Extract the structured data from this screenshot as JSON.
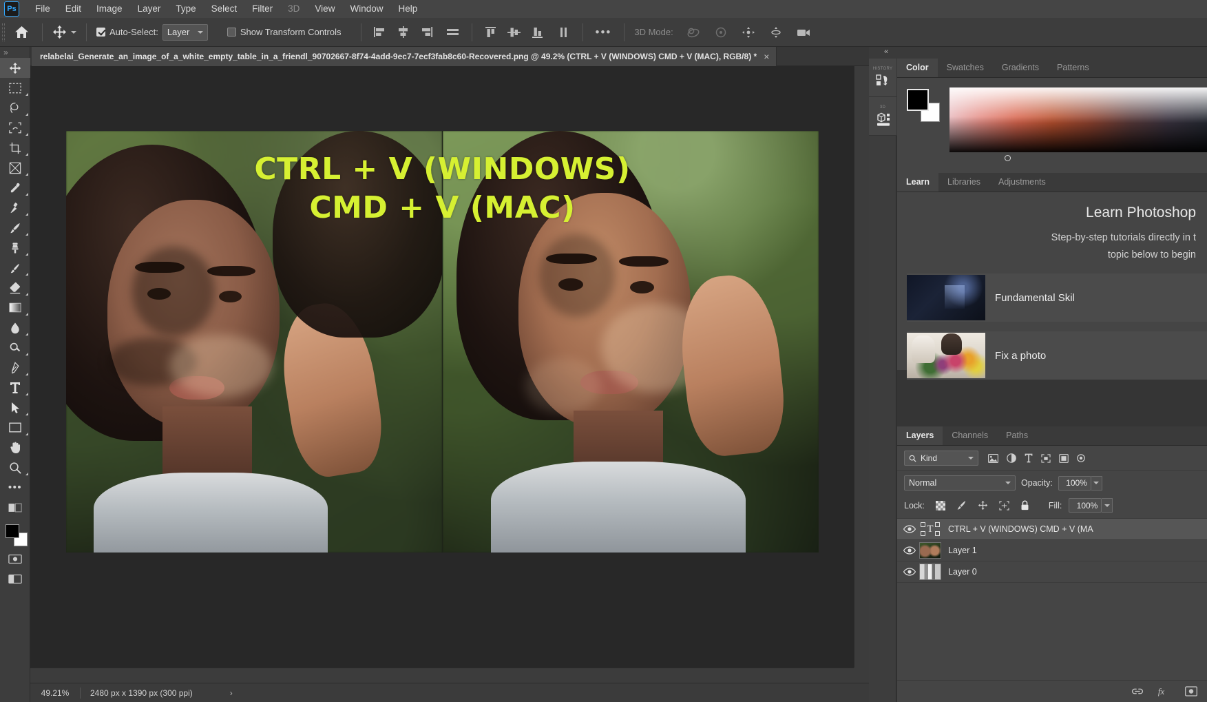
{
  "app": {
    "name": "Adobe Photoshop",
    "logo_text": "Ps"
  },
  "menubar": {
    "items": [
      {
        "label": "File"
      },
      {
        "label": "Edit"
      },
      {
        "label": "Image"
      },
      {
        "label": "Layer"
      },
      {
        "label": "Type"
      },
      {
        "label": "Select"
      },
      {
        "label": "Filter"
      },
      {
        "label": "3D"
      },
      {
        "label": "View"
      },
      {
        "label": "Window"
      },
      {
        "label": "Help"
      }
    ]
  },
  "options_bar": {
    "home_icon": "home-icon",
    "active_tool_icon": "move-tool-icon",
    "auto_select_label": "Auto-Select:",
    "auto_select_checked": true,
    "auto_select_value": "Layer",
    "show_transform_label": "Show Transform Controls",
    "show_transform_checked": false,
    "align_icons": [
      "align-left-edges-icon",
      "align-horizontal-centers-icon",
      "align-right-edges-icon",
      "distribute-vertical-centers-icon",
      "align-top-edges-icon",
      "align-vertical-centers-icon",
      "align-bottom-edges-icon",
      "distribute-icon"
    ],
    "more_label": "•••",
    "mode_3d_label": "3D Mode:",
    "mode_3d_icons": [
      "orbit-3d-icon",
      "roll-3d-icon",
      "pan-3d-icon",
      "slide-3d-icon",
      "camera-3d-icon"
    ]
  },
  "toolbar": {
    "tools": [
      {
        "name": "move-tool",
        "selected": true
      },
      {
        "name": "rectangular-marquee-tool",
        "selected": false
      },
      {
        "name": "lasso-tool",
        "selected": false
      },
      {
        "name": "object-selection-tool",
        "selected": false
      },
      {
        "name": "crop-tool",
        "selected": false
      },
      {
        "name": "frame-tool",
        "selected": false
      },
      {
        "name": "eyedropper-tool",
        "selected": false
      },
      {
        "name": "healing-brush-tool",
        "selected": false
      },
      {
        "name": "brush-tool",
        "selected": false
      },
      {
        "name": "clone-stamp-tool",
        "selected": false
      },
      {
        "name": "history-brush-tool",
        "selected": false
      },
      {
        "name": "eraser-tool",
        "selected": false
      },
      {
        "name": "gradient-tool",
        "selected": false
      },
      {
        "name": "blur-tool",
        "selected": false
      },
      {
        "name": "dodge-tool",
        "selected": false
      },
      {
        "name": "pen-tool",
        "selected": false
      },
      {
        "name": "type-tool",
        "selected": false
      },
      {
        "name": "path-selection-tool",
        "selected": false
      },
      {
        "name": "rectangle-tool",
        "selected": false
      },
      {
        "name": "hand-tool",
        "selected": false
      },
      {
        "name": "zoom-tool",
        "selected": false
      },
      {
        "name": "edit-toolbar-tool",
        "selected": false
      }
    ],
    "foreground_color": "#000000",
    "background_color": "#ffffff"
  },
  "document": {
    "tab_title": "relabelai_Generate_an_image_of_a_white_empty_table_in_a_friendl_90702667-8f74-4add-9ec7-7ecf3fab8c60-Recovered.png @ 49.2% (CTRL + V (WINDOWS) CMD + V (MAC), RGB/8) *",
    "close_label": "×",
    "overlay_line1": "CTRL + V (WINDOWS)",
    "overlay_line2": "CMD + V (MAC)",
    "overlay_color": "#d6f032"
  },
  "status_bar": {
    "zoom": "49.21%",
    "dimensions": "2480 px x 1390 px (300 ppi)",
    "arrow": "›"
  },
  "dock": {
    "collapse_icon": "collapse-panels-icon",
    "rail_buttons": [
      {
        "name": "history-rail-button",
        "caption": "HISTORY"
      },
      {
        "name": "3d-rail-button",
        "caption": "3D"
      }
    ],
    "color_group": {
      "tabs": [
        {
          "label": "Color",
          "active": true
        },
        {
          "label": "Swatches",
          "active": false
        },
        {
          "label": "Gradients",
          "active": false
        },
        {
          "label": "Patterns",
          "active": false
        }
      ],
      "foreground_color": "#000000",
      "background_color": "#ffffff"
    },
    "learn_group": {
      "tabs": [
        {
          "label": "Learn",
          "active": true
        },
        {
          "label": "Libraries",
          "active": false
        },
        {
          "label": "Adjustments",
          "active": false
        }
      ],
      "title": "Learn Photoshop",
      "subtitle_line1": "Step-by-step tutorials directly in t",
      "subtitle_line2": "topic below to begin",
      "cards": [
        {
          "title": "Fundamental Skil",
          "thumb": "room-photo-thumbnail"
        },
        {
          "title": "Fix a photo",
          "thumb": "flowers-photo-thumbnail"
        }
      ]
    },
    "layers_group": {
      "tabs": [
        {
          "label": "Layers",
          "active": true
        },
        {
          "label": "Channels",
          "active": false
        },
        {
          "label": "Paths",
          "active": false
        }
      ],
      "filter_label": "Kind",
      "filter_icons": [
        "filter-pixel-icon",
        "filter-adjustment-icon",
        "filter-type-icon",
        "filter-shape-icon",
        "filter-smart-object-icon",
        "filter-toggle-icon"
      ],
      "blend_mode": "Normal",
      "opacity_label": "Opacity:",
      "opacity_value": "100%",
      "lock_label": "Lock:",
      "lock_icons": [
        "lock-transparent-pixels-icon",
        "lock-image-pixels-icon",
        "lock-position-icon",
        "lock-artboard-nesting-icon",
        "lock-all-icon"
      ],
      "fill_label": "Fill:",
      "fill_value": "100%",
      "layers": [
        {
          "name": "CTRL + V (WINDOWS) CMD + V (MA",
          "type": "text",
          "visible": true,
          "selected": true
        },
        {
          "name": "Layer 1",
          "type": "image",
          "visible": true,
          "selected": false
        },
        {
          "name": "Layer 0",
          "type": "image",
          "visible": true,
          "selected": false
        }
      ],
      "footer_icons": [
        "link-layers-icon",
        "layer-style-fx-icon",
        "add-layer-mask-icon"
      ]
    }
  }
}
